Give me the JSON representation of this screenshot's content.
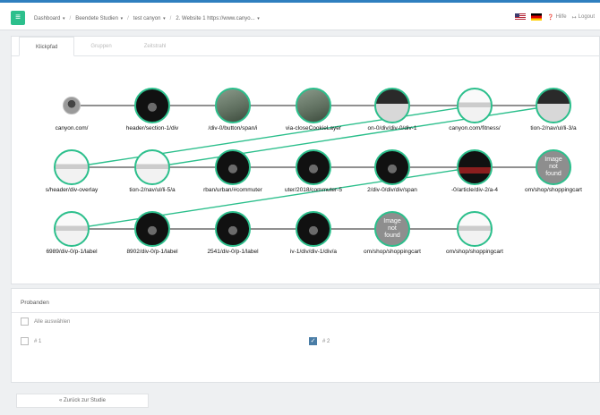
{
  "topbar": {
    "breadcrumbs": [
      "Dashboard",
      "Beendete Studien",
      "test canyon",
      "2. Website 1 https://www.canyo..."
    ],
    "help_label": "Hilfe",
    "logout_label": "Logout"
  },
  "tabs": [
    "Klickpfad",
    "Gruppen",
    "Zeitstrahl"
  ],
  "graph": {
    "nodes": [
      {
        "label": "canyon.com/",
        "thumb": "avatar"
      },
      {
        "label": "header/section-1/div",
        "thumb": "dark"
      },
      {
        "label": "/div-0/button/span/i",
        "thumb": "photo"
      },
      {
        "label": "via-closeCookieLayer",
        "thumb": "photo"
      },
      {
        "label": "on-0/div/div-0/div-1",
        "thumb": "site"
      },
      {
        "label": "canyon.com/fitness/",
        "thumb": "light"
      },
      {
        "label": "tion-2/nav/ul/li-3/a",
        "thumb": "site"
      },
      {
        "label": "s/header/div-overlay",
        "thumb": "light"
      },
      {
        "label": "tion-2/nav/ul/li-5/a",
        "thumb": "light"
      },
      {
        "label": "rban/urban/#commuter",
        "thumb": "dark"
      },
      {
        "label": "uter/2018/commuter-5",
        "thumb": "dark"
      },
      {
        "label": "2/div-0/div/div/span",
        "thumb": "dark"
      },
      {
        "label": "-0/article/div-2/a-4",
        "thumb": "red"
      },
      {
        "label": "om/shop/shoppingcart",
        "thumb": "gray",
        "missing": "Image not found"
      },
      {
        "label": "6989/div-0/p-1/label",
        "thumb": "light"
      },
      {
        "label": "8902/div-0/p-1/label",
        "thumb": "dark"
      },
      {
        "label": "2541/div-0/p-1/label",
        "thumb": "dark"
      },
      {
        "label": "iv-1/div/div-1/div/a",
        "thumb": "dark"
      },
      {
        "label": "om/shop/shoppingcart",
        "thumb": "gray",
        "missing": "Image not found"
      },
      {
        "label": "om/shop/shoppingcart",
        "thumb": "light"
      }
    ]
  },
  "participants": {
    "title": "Probanden",
    "select_all_label": "Alle auswählen",
    "items": [
      {
        "label": "# 1",
        "checked": false
      },
      {
        "label": "# 2",
        "checked": true
      }
    ]
  },
  "back_button_label": "« Zurück zur Studie",
  "colors": {
    "accent": "#2cbf8c",
    "topbar_border": "#2f7fbf"
  }
}
